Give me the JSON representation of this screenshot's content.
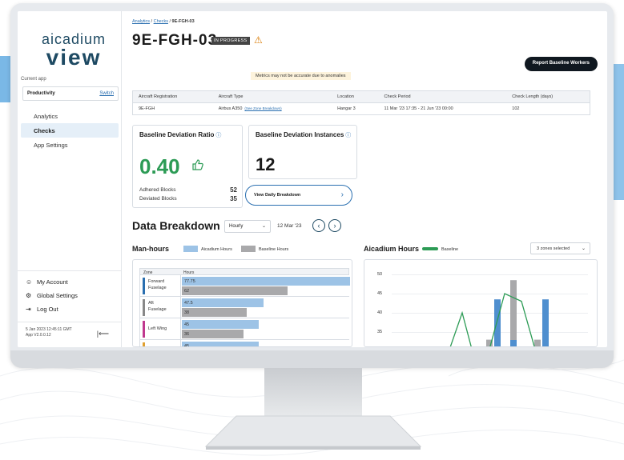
{
  "sidebar": {
    "logo_top": "aicadium",
    "logo_bottom": "view",
    "current_app_label": "Current app",
    "current_app": "Productivity",
    "switch_label": "Switch",
    "nav": [
      {
        "label": "Analytics"
      },
      {
        "label": "Checks"
      },
      {
        "label": "App Settings"
      }
    ],
    "account": [
      {
        "label": "My Account",
        "icon": "user-icon"
      },
      {
        "label": "Global Settings",
        "icon": "gear-icon"
      },
      {
        "label": "Log Out",
        "icon": "logout-icon"
      }
    ],
    "timestamp": "5 Jan 2023 12:45:11 GMT",
    "version": "App V2.0.0.12"
  },
  "breadcrumb": {
    "analytics": "Analytics",
    "sep": " / ",
    "checks": "Checks",
    "current": "9E-FGH-03"
  },
  "header": {
    "title": "9E-FGH-03",
    "status": "IN PROGRESS",
    "warning_tooltip": "Metrics may not be accurate due to anomalies",
    "report_button": "Report Baseline Workers"
  },
  "info_table": {
    "headers": [
      "Aircraft Registration",
      "Aircraft Type",
      "Location",
      "Check Period",
      "Check Length (days)"
    ],
    "registration": "9E-FGH",
    "aircraft_type": "Airbus A350",
    "zone_link": "(See Zone Breakdown)",
    "location": "Hangar 3",
    "check_period": "11 Mar '23 17:35 - 21 Jun '23 00:00",
    "check_length": "102"
  },
  "ratio_card": {
    "title": "Baseline Deviation Ratio",
    "value": "0.40",
    "adhered_label": "Adhered Blocks",
    "adhered_value": "52",
    "deviated_label": "Deviated Blocks",
    "deviated_value": "35"
  },
  "instances_card": {
    "title": "Baseline Deviation Instances",
    "value": "12",
    "button": "View Daily Breakdown"
  },
  "breakdown": {
    "title": "Data Breakdown",
    "granularity": "Hourly",
    "date": "12 Mar '23"
  },
  "man_hours": {
    "title": "Man-hours",
    "legend_a": "Aicadium Hours",
    "legend_b": "Baseline Hours",
    "col_zone": "Zone",
    "col_hours": "Hours",
    "rows": [
      {
        "zone": "Forward Fuselage",
        "zone_l1": "Forward",
        "zone_l2": "Fuselage",
        "aicadium": "77.75",
        "baseline": "62",
        "color": "#2a6fb0"
      },
      {
        "zone": "Aft Fuselage",
        "zone_l1": "Aft",
        "zone_l2": "Fuselage",
        "aicadium": "47.5",
        "baseline": "38",
        "color": "#888888"
      },
      {
        "zone": "Left Wing",
        "zone_l1": "Left Wing",
        "zone_l2": "",
        "aicadium": "45",
        "baseline": "36",
        "color": "#c0398f"
      },
      {
        "zone": "",
        "zone_l1": "",
        "zone_l2": "",
        "aicadium": "45",
        "baseline": "",
        "color": "#e0a030"
      }
    ]
  },
  "aicadium_hours": {
    "title": "Aicadium Hours",
    "legend": "Baseline",
    "zones_select": "3 zones selected",
    "yticks": [
      "50",
      "45",
      "40",
      "35"
    ]
  },
  "colors": {
    "accent_blue": "#2a6fb0",
    "good_green": "#2c9b55",
    "baseline_gray": "#a9a9ab",
    "aicadium_blue": "#9dc3e6"
  },
  "chart_data": {
    "type": "bar",
    "title": "Aicadium Hours",
    "ylim": [
      30,
      50
    ],
    "yticks": [
      50,
      45,
      40,
      35
    ],
    "series": [
      {
        "name": "Baseline",
        "type": "line",
        "color": "#2c9b55",
        "values": [
          40,
          31,
          31,
          45,
          43,
          31
        ]
      }
    ],
    "bars": [
      {
        "color": "#a9a9ab",
        "value": 33
      },
      {
        "color": "#4f8fcf",
        "value": 43.5
      },
      {
        "color": "#a9a9ab",
        "value": 48.5
      },
      {
        "color": "#a9a9ab",
        "value": 33
      },
      {
        "color": "#4f8fcf",
        "value": 43.5
      }
    ]
  }
}
